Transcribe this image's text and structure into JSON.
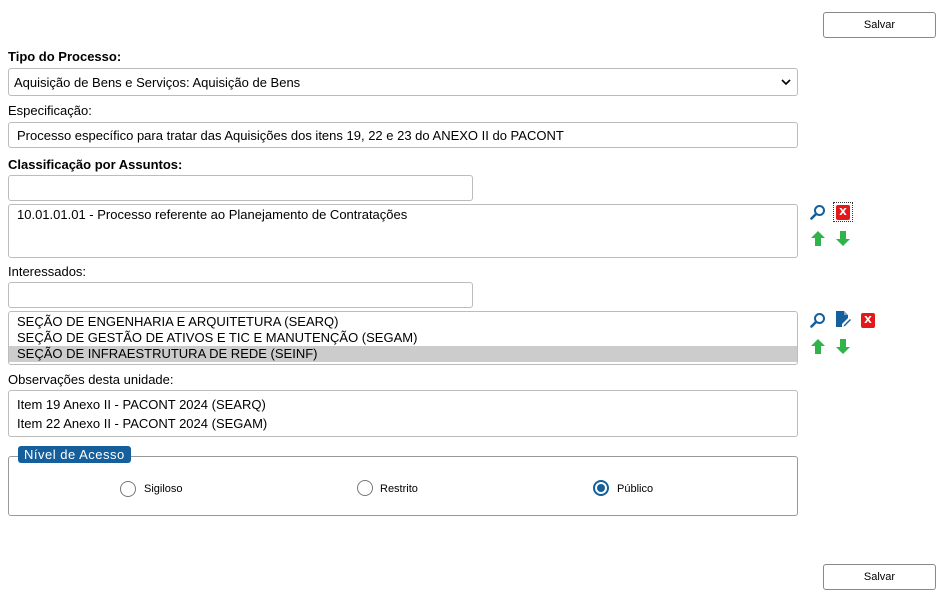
{
  "buttons": {
    "save_top": "Salvar",
    "save_bottom": "Salvar"
  },
  "tipo": {
    "label": "Tipo do Processo:",
    "value": "Aquisição de Bens e Serviços: Aquisição de Bens"
  },
  "especificacao": {
    "label": "Especificação:",
    "value": "Processo específico para tratar das Aquisições dos itens 19, 22 e 23 do ANEXO II do PACONT"
  },
  "assuntos": {
    "label": "Classificação por Assuntos:",
    "search_value": "",
    "items": [
      "10.01.01.01 - Processo referente ao Planejamento de Contratações"
    ]
  },
  "interessados": {
    "label": "Interessados:",
    "search_value": "",
    "items": [
      "SEÇÃO DE ENGENHARIA E ARQUITETURA (SEARQ)",
      "SEÇÃO DE GESTÃO DE ATIVOS E TIC E MANUTENÇÃO (SEGAM)",
      "SEÇÃO DE INFRAESTRUTURA DE REDE (SEINF)"
    ],
    "selected_index": 2
  },
  "observacoes": {
    "label": "Observações desta unidade:",
    "lines": [
      "Item 19 Anexo II - PACONT 2024 (SEARQ)",
      "Item 22 Anexo II - PACONT 2024 (SEGAM)"
    ]
  },
  "acesso": {
    "legend": "Nível de Acesso",
    "options": [
      "Sigiloso",
      "Restrito",
      "Público"
    ],
    "selected": "Público"
  },
  "icons": {
    "remove_glyph": "X"
  },
  "colors": {
    "accent": "#155f9c",
    "green_arrow": "#2fb34a",
    "remove_red": "#e31818"
  }
}
